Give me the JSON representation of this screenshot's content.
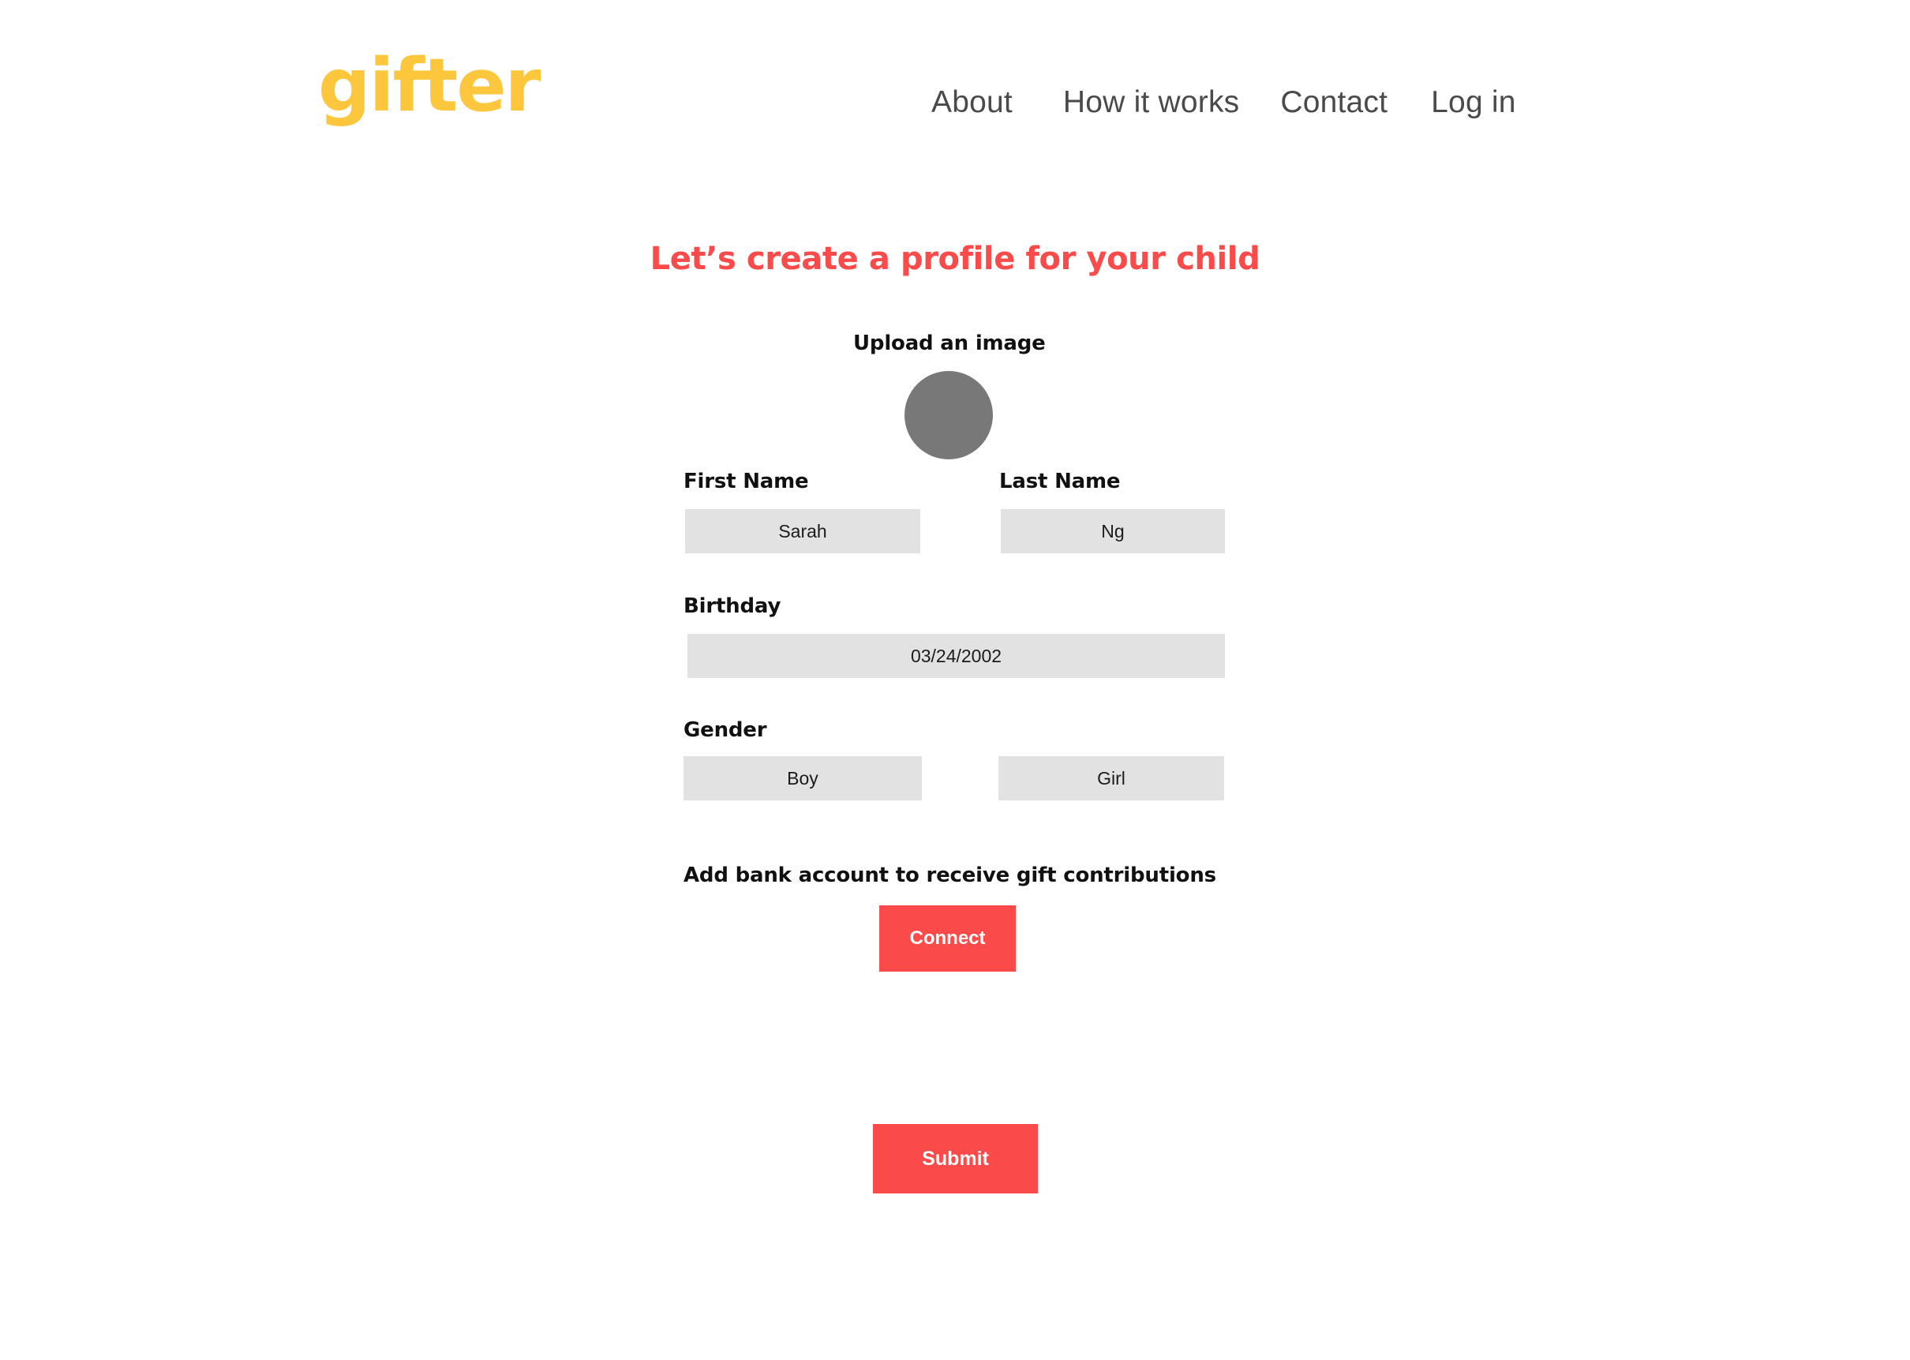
{
  "brand": {
    "name": "gifter",
    "color": "#fcc73c"
  },
  "nav": {
    "items": [
      {
        "label": "About"
      },
      {
        "label": "How it works"
      },
      {
        "label": "Contact"
      },
      {
        "label": "Log in"
      }
    ],
    "color": "#4a4a4a"
  },
  "page": {
    "heading": "Let’s create a profile for your child",
    "heading_color": "#fb4a4a",
    "background": "#ffffff"
  },
  "form": {
    "upload": {
      "label": "Upload an image",
      "avatar_color": "#787878"
    },
    "first_name": {
      "label": "First Name",
      "value": "Sarah"
    },
    "last_name": {
      "label": "Last Name",
      "value": "Ng"
    },
    "birthday": {
      "label": "Birthday",
      "value": "03/24/2002"
    },
    "gender": {
      "label": "Gender",
      "options": [
        {
          "label": "Boy"
        },
        {
          "label": "Girl"
        }
      ]
    },
    "bank": {
      "label": "Add bank account to receive gift contributions",
      "connect_button": "Connect"
    },
    "submit_button": "Submit",
    "field_background": "#e2e2e2",
    "accent_color": "#fb4a4a"
  }
}
